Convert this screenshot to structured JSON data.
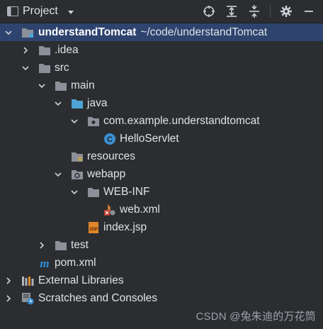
{
  "toolbar": {
    "title": "Project",
    "icons": [
      "project-view-icon",
      "chevron-down-icon",
      "locate-icon",
      "expand-all-icon",
      "collapse-all-icon",
      "gear-icon",
      "minimize-icon"
    ]
  },
  "tree": {
    "root_name": "understandTomcat",
    "root_path": "~/code/understandTomcat",
    "items": {
      "idea": ".idea",
      "src": "src",
      "main": "main",
      "java": "java",
      "package": "com.example.understandtomcat",
      "servlet": "HelloServlet",
      "resources": "resources",
      "webapp": "webapp",
      "webinf": "WEB-INF",
      "webxml": "web.xml",
      "indexjsp": "index.jsp",
      "test": "test",
      "pom": "pom.xml",
      "libraries": "External Libraries",
      "scratches": "Scratches and Consoles"
    }
  },
  "icon_labels": {
    "jsp_badge": "JSP",
    "class_badge": "C",
    "maven_badge": "m"
  },
  "watermark": "CSDN @兔朱迪的万花筒",
  "colors": {
    "background": "#2b2d30",
    "selection": "#2e436e",
    "folder": "#8c9199",
    "source_folder": "#4fa3d6",
    "class_icon": "#3d8fd1",
    "jsp": "#e0862b",
    "maven": "#2f8fd6"
  }
}
